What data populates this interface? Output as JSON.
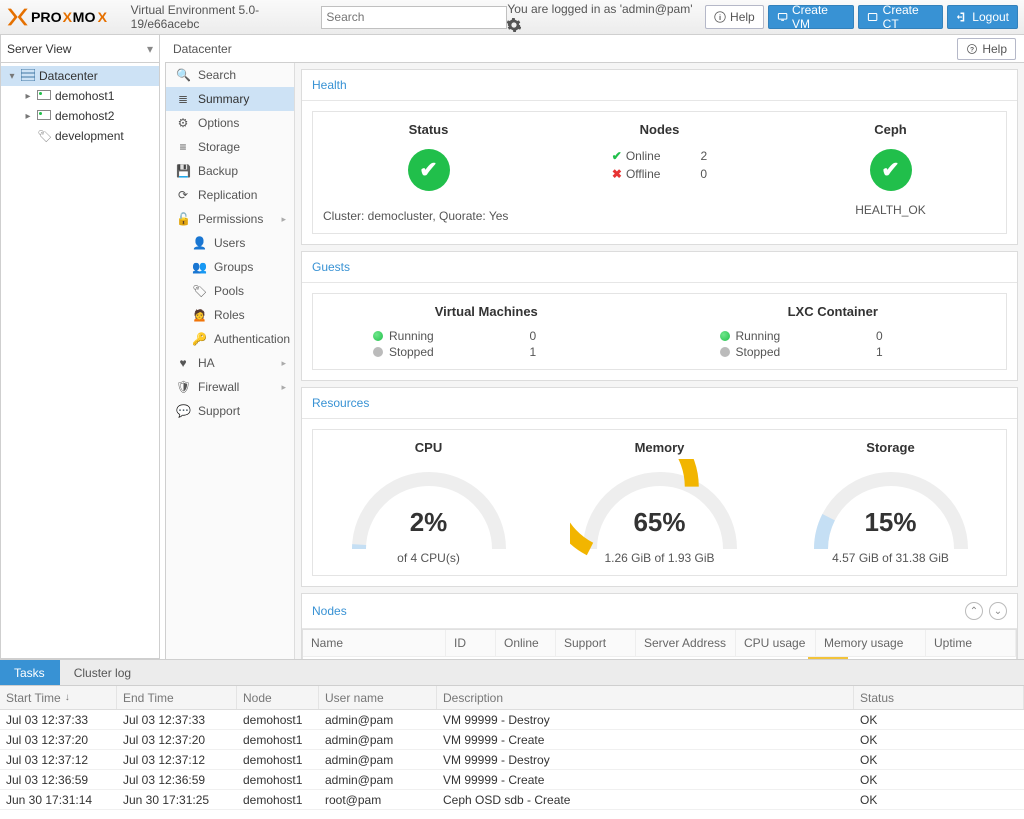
{
  "header": {
    "product": "PROXMOX",
    "version": "Virtual Environment 5.0-19/e66acebc",
    "search_placeholder": "Search",
    "logged_in": "You are logged in as 'admin@pam'",
    "help": "Help",
    "create_vm": "Create VM",
    "create_ct": "Create CT",
    "logout": "Logout"
  },
  "view_selector": "Server View",
  "breadcrumb": {
    "title": "Datacenter",
    "help": "Help"
  },
  "tree": {
    "root": "Datacenter",
    "nodes": [
      "demohost1",
      "demohost2"
    ],
    "pools": [
      "development"
    ]
  },
  "sidebar": {
    "items": [
      {
        "label": "Search",
        "icon": "search"
      },
      {
        "label": "Summary",
        "icon": "list",
        "sel": true
      },
      {
        "label": "Options",
        "icon": "gear"
      },
      {
        "label": "Storage",
        "icon": "db"
      },
      {
        "label": "Backup",
        "icon": "save"
      },
      {
        "label": "Replication",
        "icon": "refresh"
      },
      {
        "label": "Permissions",
        "icon": "lock",
        "expand": true
      },
      {
        "label": "Users",
        "icon": "user",
        "sub": true
      },
      {
        "label": "Groups",
        "icon": "users",
        "sub": true
      },
      {
        "label": "Pools",
        "icon": "tags",
        "sub": true
      },
      {
        "label": "Roles",
        "icon": "male",
        "sub": true
      },
      {
        "label": "Authentication",
        "icon": "key",
        "sub": true
      },
      {
        "label": "HA",
        "icon": "heart",
        "expand": true
      },
      {
        "label": "Firewall",
        "icon": "shield",
        "expand": true
      },
      {
        "label": "Support",
        "icon": "comment"
      }
    ]
  },
  "health": {
    "title": "Health",
    "status_h": "Status",
    "cluster": "Cluster: democluster, Quorate: Yes",
    "nodes_h": "Nodes",
    "online_l": "Online",
    "online_v": "2",
    "offline_l": "Offline",
    "offline_v": "0",
    "ceph_h": "Ceph",
    "ceph_status": "HEALTH_OK"
  },
  "guests": {
    "title": "Guests",
    "vm_h": "Virtual Machines",
    "lxc_h": "LXC Container",
    "running": "Running",
    "stopped": "Stopped",
    "vm_run": "0",
    "vm_stop": "1",
    "lxc_run": "0",
    "lxc_stop": "1"
  },
  "resources": {
    "title": "Resources",
    "cpu_h": "CPU",
    "cpu_pct": "2%",
    "cpu_sub": "of 4 CPU(s)",
    "mem_h": "Memory",
    "mem_pct": "65%",
    "mem_sub": "1.26 GiB of 1.93 GiB",
    "sto_h": "Storage",
    "sto_pct": "15%",
    "sto_sub": "4.57 GiB of 31.38 GiB"
  },
  "chart_data": [
    {
      "type": "gauge",
      "title": "CPU",
      "value": 2,
      "max": 100,
      "unit": "%",
      "subtitle": "of 4 CPU(s)"
    },
    {
      "type": "gauge",
      "title": "Memory",
      "value": 65,
      "max": 100,
      "unit": "%",
      "subtitle": "1.26 GiB of 1.93 GiB"
    },
    {
      "type": "gauge",
      "title": "Storage",
      "value": 15,
      "max": 100,
      "unit": "%",
      "subtitle": "4.57 GiB of 31.38 GiB"
    }
  ],
  "nodes_panel": {
    "title": "Nodes",
    "cols": [
      "Name",
      "ID",
      "Online",
      "Support",
      "Server Address",
      "CPU usage",
      "Memory usage",
      "Uptime"
    ]
  },
  "log": {
    "tabs": [
      "Tasks",
      "Cluster log"
    ],
    "cols": [
      "Start Time",
      "End Time",
      "Node",
      "User name",
      "Description",
      "Status"
    ],
    "rows": [
      {
        "st": "Jul 03 12:37:33",
        "et": "Jul 03 12:37:33",
        "nd": "demohost1",
        "un": "admin@pam",
        "ds": "VM 99999 - Destroy",
        "ss": "OK"
      },
      {
        "st": "Jul 03 12:37:20",
        "et": "Jul 03 12:37:20",
        "nd": "demohost1",
        "un": "admin@pam",
        "ds": "VM 99999 - Create",
        "ss": "OK"
      },
      {
        "st": "Jul 03 12:37:12",
        "et": "Jul 03 12:37:12",
        "nd": "demohost1",
        "un": "admin@pam",
        "ds": "VM 99999 - Destroy",
        "ss": "OK"
      },
      {
        "st": "Jul 03 12:36:59",
        "et": "Jul 03 12:36:59",
        "nd": "demohost1",
        "un": "admin@pam",
        "ds": "VM 99999 - Create",
        "ss": "OK"
      },
      {
        "st": "Jun 30 17:31:14",
        "et": "Jun 30 17:31:25",
        "nd": "demohost1",
        "un": "root@pam",
        "ds": "Ceph OSD sdb - Create",
        "ss": "OK"
      }
    ]
  }
}
